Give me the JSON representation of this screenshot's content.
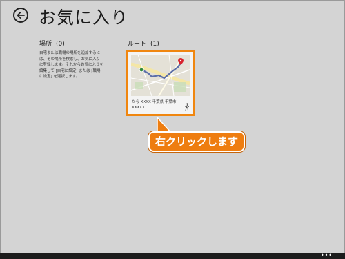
{
  "header": {
    "title": "お気に入り"
  },
  "places": {
    "label": "場所",
    "count": "(0)",
    "description": "自宅または職場の場所を追加するには、その場所を検索し、お気に入りに登録します。それからお気に入りを編集して [自宅に設定] または [職場に設定] を選択します。"
  },
  "routes": {
    "label": "ルート",
    "count": "(1)",
    "items": [
      {
        "text": "から XXXX 千葉県 千葉市\nXXXXX",
        "mode_icon": "walk-icon"
      }
    ]
  },
  "callout": {
    "text": "右クリックします"
  },
  "appbar": {
    "more_label": "•••"
  },
  "colors": {
    "background": "#d4d4d4",
    "accent": "#ee7d10",
    "route_line": "#5b6ea8",
    "pin": "#d9232d"
  }
}
